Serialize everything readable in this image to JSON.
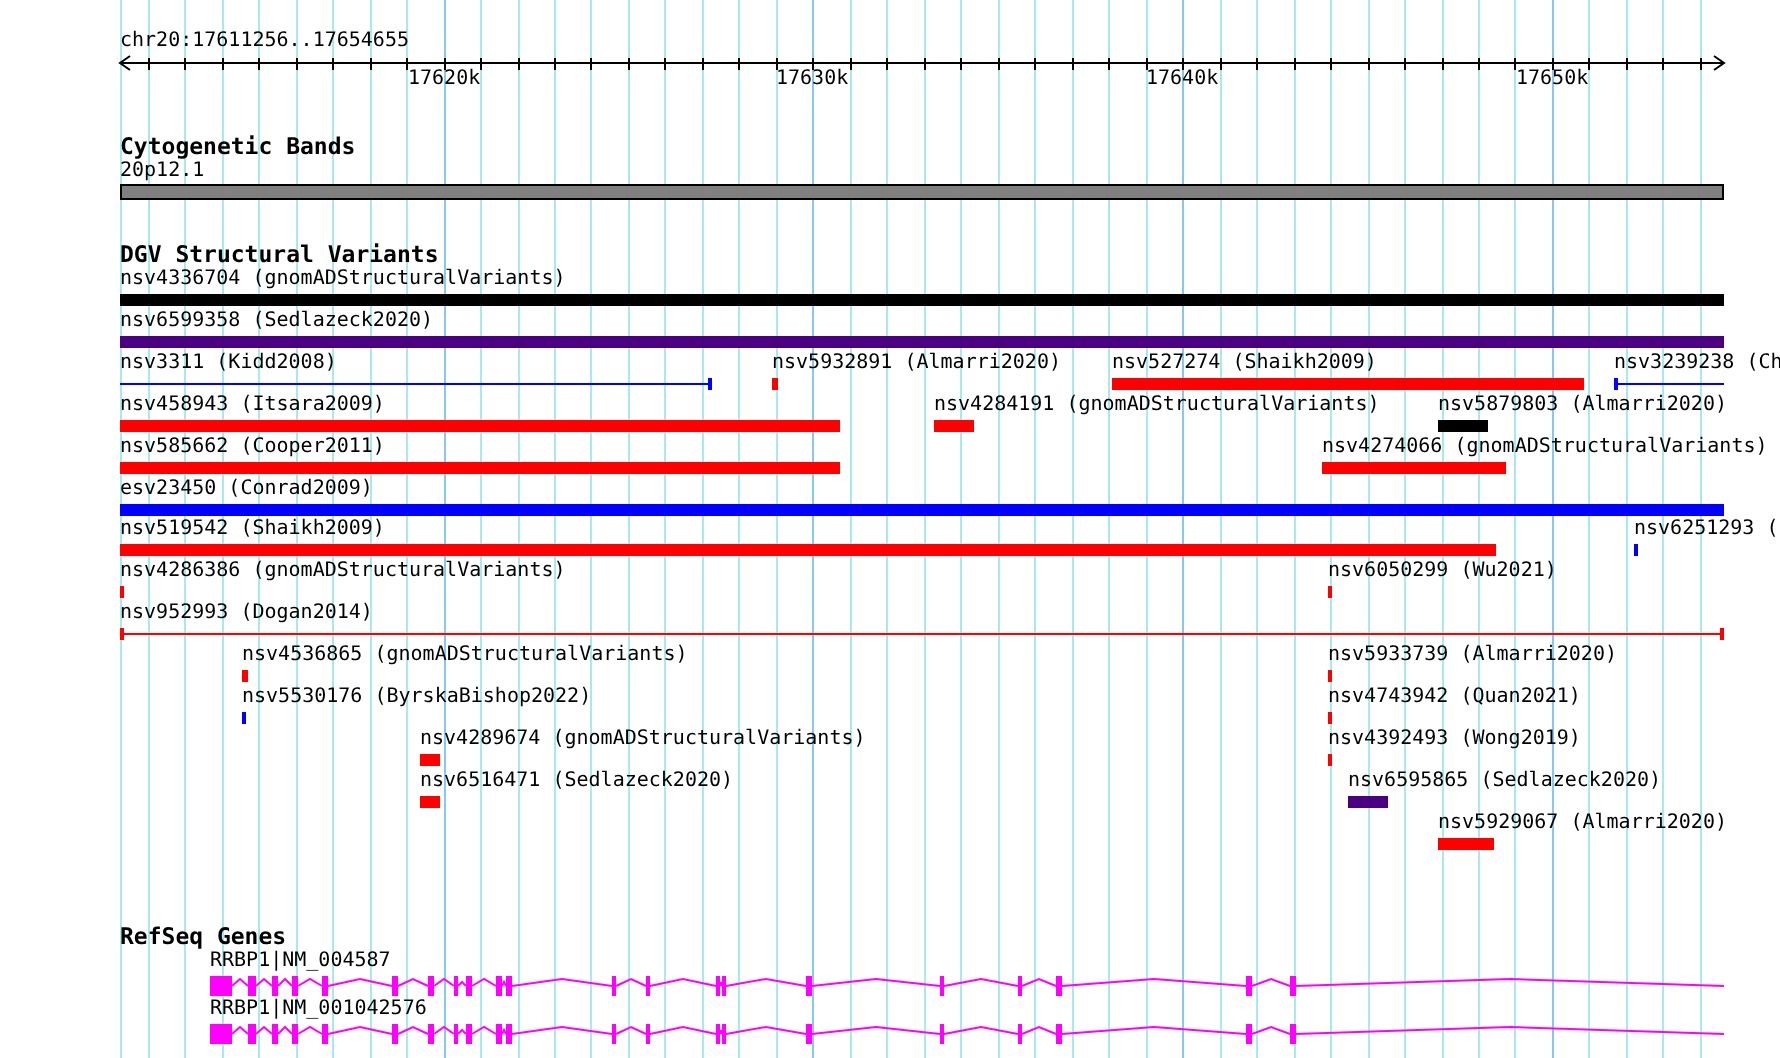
{
  "ruler": {
    "location": "chr20:17611256..17654655",
    "ticks": [
      "17620k",
      "17630k",
      "17640k",
      "17650k"
    ]
  },
  "tracks": [
    {
      "kind": "cytoband",
      "title": "Cytogenetic Bands",
      "features": [
        {
          "label": "20p12.1",
          "color": "#808080"
        }
      ]
    },
    {
      "kind": "variants",
      "title": "DGV Structural Variants",
      "features": [
        {
          "label": "nsv4336704 (gnomADStructuralVariants)",
          "kind": "bar",
          "color": "#000000"
        },
        {
          "label": "nsv6599358 (Sedlazeck2020)",
          "kind": "bar",
          "color": "#4b0082"
        },
        {
          "label": "nsv3311 (Kidd2008)",
          "kind": "line",
          "color": "#0000ff"
        },
        {
          "label": "nsv5932891 (Almarri2020)",
          "kind": "bar",
          "color": "#ff0000"
        },
        {
          "label": "nsv527274 (Shaikh2009)",
          "kind": "bar",
          "color": "#ff0000"
        },
        {
          "label": "nsv3239238 (Ch",
          "kind": "line",
          "color": "#0000ff"
        },
        {
          "label": "nsv458943 (Itsara2009)",
          "kind": "bar",
          "color": "#ff0000"
        },
        {
          "label": "nsv4284191 (gnomADStructuralVariants)",
          "kind": "bar",
          "color": "#ff0000"
        },
        {
          "label": "nsv5879803 (Almarri2020)",
          "kind": "bar",
          "color": "#000000"
        },
        {
          "label": "nsv585662 (Cooper2011)",
          "kind": "bar",
          "color": "#ff0000"
        },
        {
          "label": "nsv4274066 (gnomADStructuralVariants)",
          "kind": "bar",
          "color": "#ff0000"
        },
        {
          "label": "esv23450 (Conrad2009)",
          "kind": "bar",
          "color": "#0000ff"
        },
        {
          "label": "nsv519542 (Shaikh2009)",
          "kind": "bar",
          "color": "#ff0000"
        },
        {
          "label": "nsv6251293 (",
          "kind": "bar",
          "color": "#0000ff"
        },
        {
          "label": "nsv4286386 (gnomADStructuralVariants)",
          "kind": "bar",
          "color": "#ff0000"
        },
        {
          "label": "nsv6050299 (Wu2021)",
          "kind": "bar",
          "color": "#ff0000"
        },
        {
          "label": "nsv952993 (Dogan2014)",
          "kind": "line",
          "color": "#ff0000"
        },
        {
          "label": "nsv4536865 (gnomADStructuralVariants)",
          "kind": "bar",
          "color": "#ff0000"
        },
        {
          "label": "nsv5933739 (Almarri2020)",
          "kind": "bar",
          "color": "#ff0000"
        },
        {
          "label": "nsv5530176 (ByrskaBishop2022)",
          "kind": "bar",
          "color": "#0000ff"
        },
        {
          "label": "nsv4743942 (Quan2021)",
          "kind": "bar",
          "color": "#ff0000"
        },
        {
          "label": "nsv4289674 (gnomADStructuralVariants)",
          "kind": "bar",
          "color": "#ff0000"
        },
        {
          "label": "nsv4392493 (Wong2019)",
          "kind": "bar",
          "color": "#ff0000"
        },
        {
          "label": "nsv6516471 (Sedlazeck2020)",
          "kind": "bar",
          "color": "#ff0000"
        },
        {
          "label": "nsv6595865 (Sedlazeck2020)",
          "kind": "bar",
          "color": "#4b0082"
        },
        {
          "label": "nsv5929067 (Almarri2020)",
          "kind": "bar",
          "color": "#ff0000"
        }
      ]
    },
    {
      "kind": "genes",
      "title": "RefSeq Genes",
      "features": [
        {
          "label": "RRBP1|NM_004587",
          "kind": "transcript",
          "color": "#ff00ff"
        },
        {
          "label": "RRBP1|NM_001042576",
          "kind": "transcript",
          "color": "#ff00ff"
        }
      ]
    }
  ]
}
